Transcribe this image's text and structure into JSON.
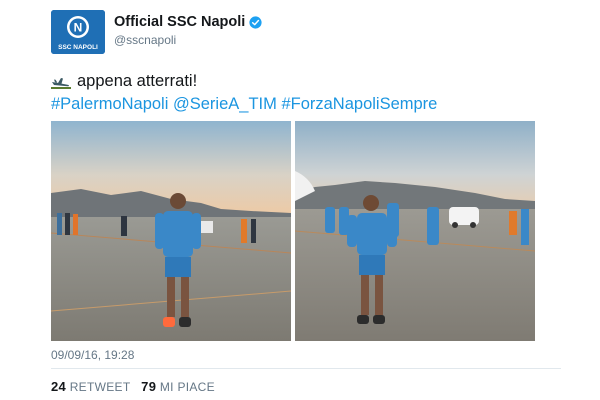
{
  "account": {
    "display_name": "Official SSC Napoli",
    "handle": "@sscnapoli",
    "avatar_text": "SSC NAPOLI",
    "avatar_letter": "N",
    "verified_icon": "verified-badge-icon"
  },
  "tweet": {
    "text": "appena atterrati!",
    "leading_emoji": "airplane-arriving-icon",
    "hashtags": [
      "#PalermoNapoli",
      "@SerieA_TIM",
      "#ForzaNapoliSempre"
    ]
  },
  "media": [
    {
      "label": "photo-1"
    },
    {
      "label": "photo-2"
    }
  ],
  "meta": {
    "timestamp": "09/09/16, 19:28",
    "retweets_count": "24",
    "retweets_label": "RETWEET",
    "likes_count": "79",
    "likes_label": "MI PIACE"
  },
  "colors": {
    "link": "#1b95e0",
    "brand_blue": "#1f6fb5",
    "muted": "#657786",
    "verified": "#1da1f2"
  }
}
